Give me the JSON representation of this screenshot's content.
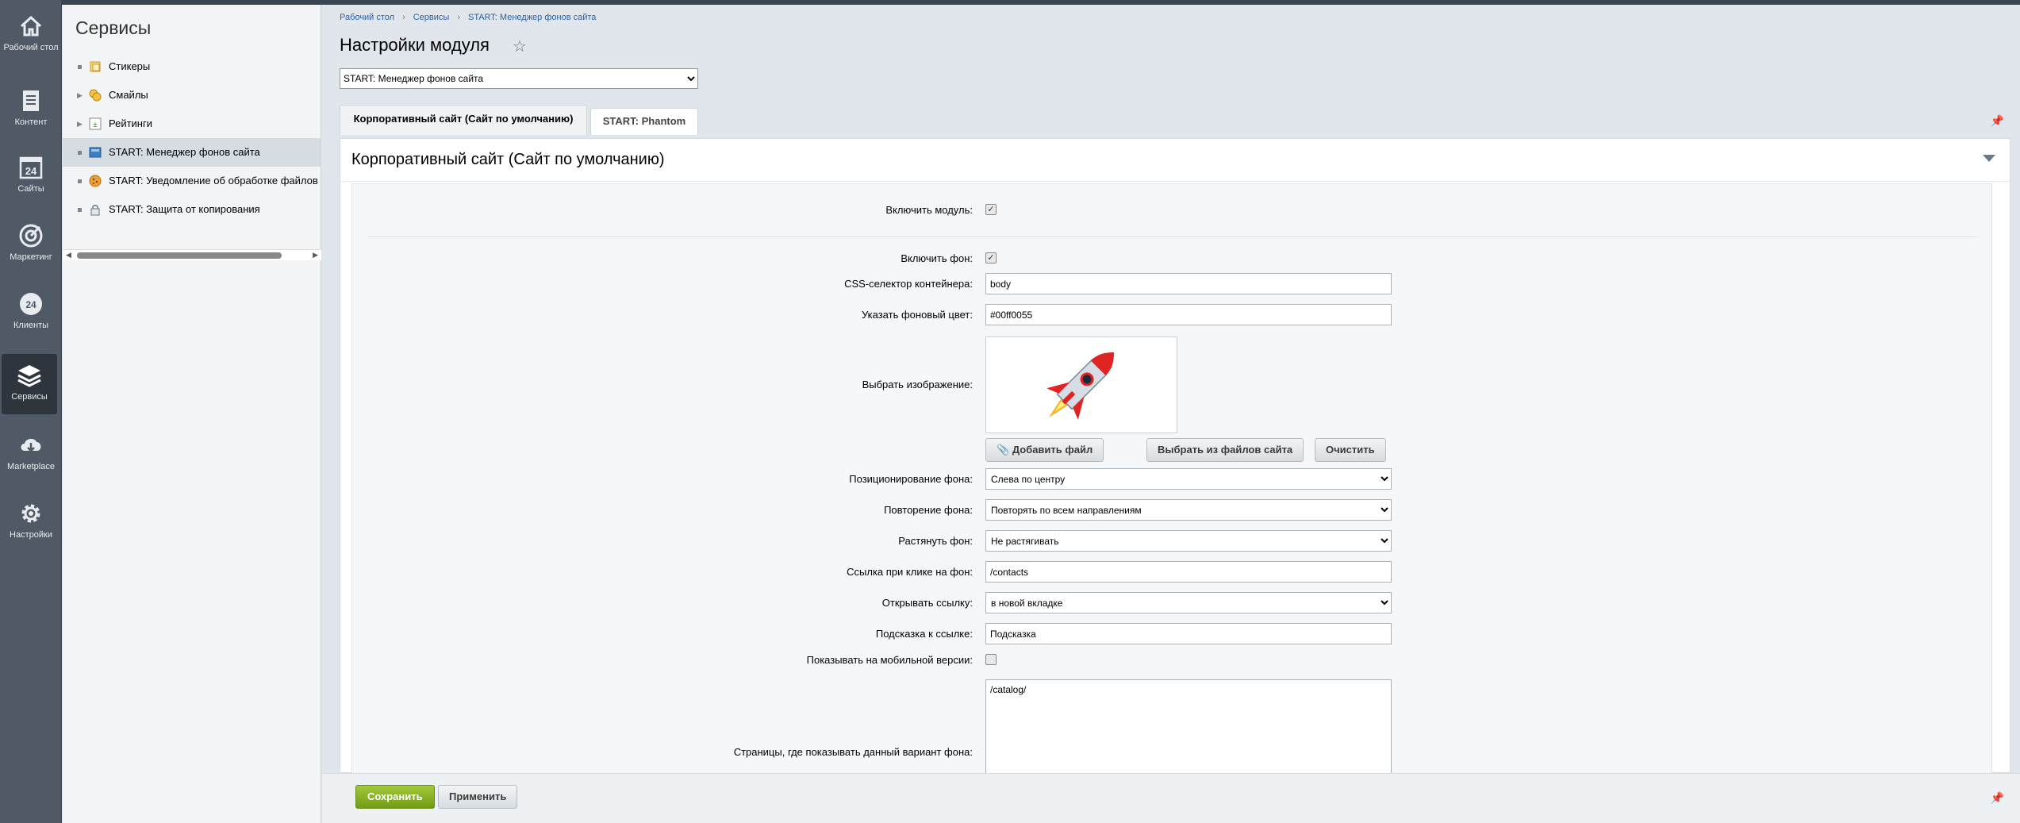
{
  "rail": {
    "items": [
      {
        "label": "Рабочий стол",
        "icon": "home-icon"
      },
      {
        "label": "Контент",
        "icon": "document-icon"
      },
      {
        "label": "Сайты",
        "icon": "calendar-24-icon"
      },
      {
        "label": "Маркетинг",
        "icon": "target-icon"
      },
      {
        "label": "Клиенты",
        "icon": "clients-24-icon"
      },
      {
        "label": "Сервисы",
        "icon": "layers-icon"
      },
      {
        "label": "Marketplace",
        "icon": "cloud-download-icon"
      },
      {
        "label": "Настройки",
        "icon": "gear-icon"
      }
    ],
    "active": "Сервисы"
  },
  "sidebar": {
    "title": "Сервисы",
    "items": [
      {
        "label": "Стикеры",
        "expandable": false
      },
      {
        "label": "Смайлы",
        "expandable": true
      },
      {
        "label": "Рейтинги",
        "expandable": true
      },
      {
        "label": "START: Менеджер фонов сайта",
        "expandable": false,
        "selected": true
      },
      {
        "label": "START: Уведомление об обработке файлов c",
        "expandable": false
      },
      {
        "label": "START: Защита от копирования",
        "expandable": false
      }
    ]
  },
  "breadcrumb": [
    "Рабочий стол",
    "Сервисы",
    "START: Менеджер фонов сайта"
  ],
  "page": {
    "title": "Настройки модуля",
    "module_select": "START: Менеджер фонов сайта"
  },
  "tabs": [
    {
      "label": "Корпоративный сайт (Сайт по умолчанию)",
      "active": true
    },
    {
      "label": "START: Phantom",
      "active": false
    }
  ],
  "panel": {
    "title": "Корпоративный сайт (Сайт по умолчанию)"
  },
  "form": {
    "enable_module_label": "Включить модуль:",
    "enable_module_checked": true,
    "enable_bg_label": "Включить фон:",
    "enable_bg_checked": true,
    "css_selector_label": "CSS-селектор контейнера:",
    "css_selector_value": "body",
    "bg_color_label": "Указать фоновый цвет:",
    "bg_color_value": "#00ff0055",
    "image_label": "Выбрать изображение:",
    "add_file_button": "Добавить файл",
    "choose_site_files_button": "Выбрать из файлов сайта",
    "clear_button": "Очистить",
    "position_label": "Позиционирование фона:",
    "position_value": "Слева по центру",
    "repeat_label": "Повторение фона:",
    "repeat_value": "Повторять по всем направлениям",
    "stretch_label": "Растянуть фон:",
    "stretch_value": "Не растягивать",
    "link_label": "Ссылка при клике на фон:",
    "link_value": "/contacts",
    "open_link_label": "Открывать ссылку:",
    "open_link_value": "в новой вкладке",
    "hint_label": "Подсказка к ссылке:",
    "hint_value": "Подсказка",
    "mobile_label": "Показывать на мобильной версии:",
    "mobile_checked": false,
    "pages_label": "Страницы, где показывать данный вариант фона:",
    "pages_value": "/catalog/"
  },
  "footer": {
    "save_button": "Сохранить",
    "apply_button": "Применить"
  },
  "colors": {
    "rail_bg": "#505a66",
    "save_green": "#8bb32a",
    "link_blue": "#2b5ea8"
  }
}
